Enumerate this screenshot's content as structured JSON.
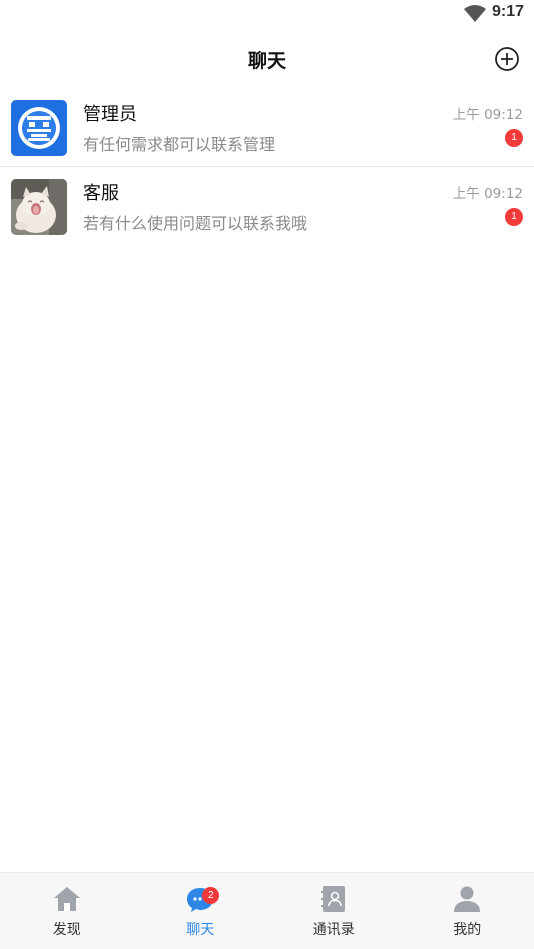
{
  "status_bar": {
    "time": "9:17",
    "wifi_icon": "wifi-icon"
  },
  "header": {
    "title": "聊天",
    "add_icon": "plus-circle-icon"
  },
  "chats": [
    {
      "name": "管理员",
      "preview": "有任何需求都可以联系管理",
      "time": "上午 09:12",
      "unread": "1",
      "avatar_icon": "admin-logo-icon"
    },
    {
      "name": "客服",
      "preview": "若有什么使用问题可以联系我哦",
      "time": "上午 09:12",
      "unread": "1",
      "avatar_icon": "cat-photo-avatar"
    }
  ],
  "bottom_nav": {
    "items": [
      {
        "label": "发现",
        "icon": "home-icon"
      },
      {
        "label": "聊天",
        "icon": "chat-bubble-icon",
        "badge": "2",
        "active": true
      },
      {
        "label": "通讯录",
        "icon": "contacts-book-icon"
      },
      {
        "label": "我的",
        "icon": "person-icon"
      }
    ]
  },
  "colors": {
    "accent": "#2e86e6",
    "badge": "#f23a3a",
    "nav_inactive_icon": "#a0a4ab"
  }
}
